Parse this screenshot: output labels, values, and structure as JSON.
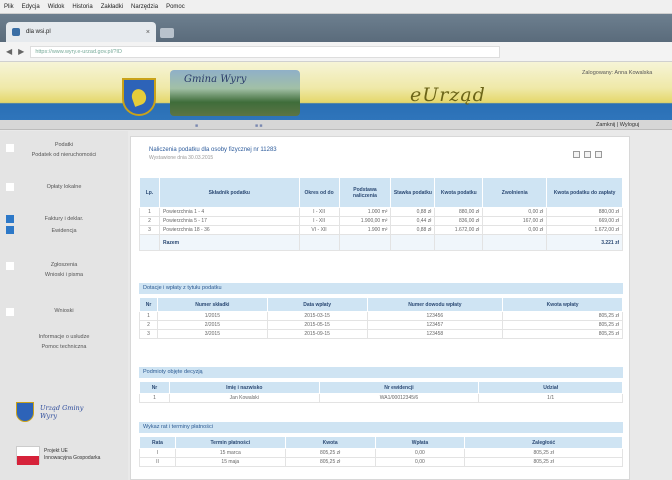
{
  "browser": {
    "menu": [
      "Plik",
      "Edycja",
      "Widok",
      "Historia",
      "Zakładki",
      "Narzędzia",
      "Pomoc"
    ],
    "tab_title": "dla wsi.pl",
    "tab_close": "×",
    "url": "https://www.wyry.e-urzad.gov.pl/?ID"
  },
  "header": {
    "photo_title": "Gmina Wyry",
    "script_title": "eUrząd",
    "top_right": "Zalogowany: Anna Kowalska",
    "subnav_right": "Zamknij | Wyloguj"
  },
  "sidebar": {
    "items": [
      {
        "label": "Podatki",
        "label2": "Podatek od nieruchomości",
        "active": false
      },
      {
        "label": "Opłaty lokalne",
        "active": false
      },
      {
        "label": "Faktury i deklar.",
        "active": true
      },
      {
        "label": "Ewidencja",
        "active": true
      },
      {
        "label": "Zgłoszenia",
        "label2": "Wnioski i pisma",
        "active": false
      },
      {
        "label": "Wnioski",
        "active": false
      },
      {
        "label": "Informacje o usłudze",
        "label2": "Pomoc techniczna",
        "active": false
      }
    ],
    "logo_text": [
      "Urząd Gminy",
      "Wyry"
    ],
    "flag_text": [
      "Projekt UE",
      "Innowacyjna Gospodarka"
    ]
  },
  "main": {
    "title": "Naliczenia podatku dla osoby fizycznej nr 11283",
    "subtitle": "Wystawione dnia 30.03.2015",
    "table1": {
      "headers": [
        "Lp.",
        "Składnik podatku",
        "Okres od do",
        "Podstawa naliczenia",
        "Stawka podatku",
        "Kwota podatku",
        "Zwolnienia",
        "Kwota podatku do zapłaty"
      ],
      "rows": [
        [
          "1",
          "Powierzchnia 1 - 4",
          "I - XII",
          "1.000 m²",
          "0,88 zł",
          "880,00 zł",
          "0,00 zł",
          "880,00 zł"
        ],
        [
          "2",
          "Powierzchnia 5 - 17",
          "I - XII",
          "1.900,00 m²",
          "0,44 zł",
          "836,00 zł",
          "167,00 zł",
          "669,00 zł"
        ],
        [
          "3",
          "Powierzchnia 18 - 36",
          "VI - XII",
          "1.900 m²",
          "0,88 zł",
          "1.672,00 zł",
          "0,00 zł",
          "1.672,00 zł"
        ]
      ],
      "sum_label": "Razem",
      "sum_value": "3.221 zł"
    },
    "section2": {
      "title": "Dotacje i wpłaty z tytułu podatku",
      "headers": [
        "Nr",
        "Numer składki",
        "Data wpłaty",
        "Numer dowodu wpłaty",
        "Kwota wpłaty"
      ],
      "rows": [
        [
          "1",
          "1/2015",
          "2015-03-15",
          "123456",
          "805,25 zł"
        ],
        [
          "2",
          "2/2015",
          "2015-05-15",
          "123457",
          "805,25 zł"
        ],
        [
          "3",
          "3/2015",
          "2015-09-15",
          "123458",
          "805,25 zł"
        ]
      ]
    },
    "section3": {
      "title": "Podmioty objęte decyzją",
      "headers": [
        "Nr",
        "Imię i nazwisko",
        "Nr ewidencji",
        "Udział"
      ],
      "rows": [
        [
          "1",
          "Jan Kowalski",
          "WA1/00012345/6",
          "1/1"
        ]
      ]
    },
    "section4": {
      "title": "Wykaz rat i terminy płatności",
      "headers": [
        "Rata",
        "Termin płatności",
        "Kwota",
        "Wpłata",
        "Zaległość"
      ],
      "rows": [
        [
          "I",
          "15 marca",
          "805,25 zł",
          "0,00",
          "805,25 zł"
        ],
        [
          "II",
          "15 maja",
          "805,25 zł",
          "0,00",
          "805,25 zł"
        ]
      ]
    }
  }
}
